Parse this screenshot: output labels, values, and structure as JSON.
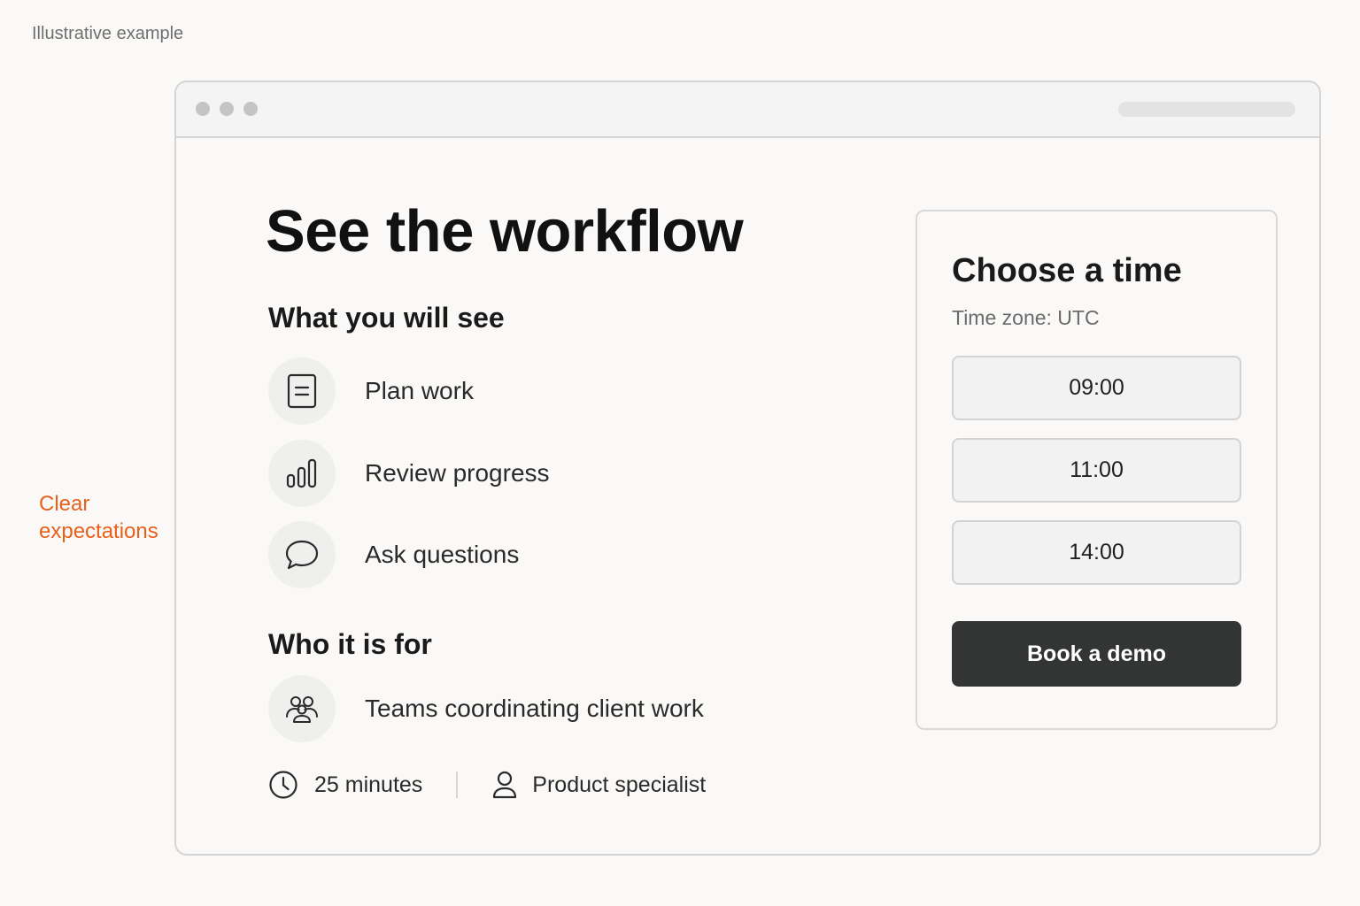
{
  "caption": "Illustrative example",
  "annotation": {
    "label": "Clear expectations",
    "color": "#e8601c"
  },
  "page": {
    "title": "See the workflow",
    "what_heading": "What you will see",
    "features": [
      {
        "icon": "document-icon",
        "label": "Plan work"
      },
      {
        "icon": "bar-chart-icon",
        "label": "Review progress"
      },
      {
        "icon": "chat-bubble-icon",
        "label": "Ask questions"
      }
    ],
    "who_heading": "Who it is for",
    "audience": {
      "icon": "group-icon",
      "label": "Teams coordinating client work"
    },
    "meta": {
      "duration": {
        "icon": "clock-icon",
        "label": "25 minutes"
      },
      "host": {
        "icon": "person-icon",
        "label": "Product specialist"
      }
    }
  },
  "booking": {
    "title": "Choose a time",
    "timezone": "Time zone: UTC",
    "slots": [
      "09:00",
      "11:00",
      "14:00"
    ],
    "button_label": "Book a demo",
    "button_color": "#333534"
  }
}
